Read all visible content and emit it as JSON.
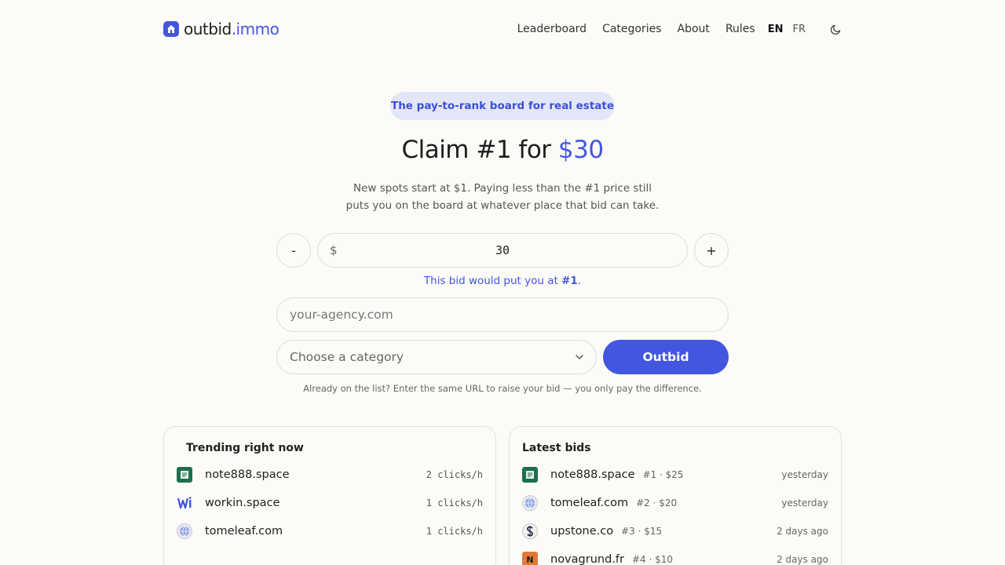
{
  "header": {
    "logo_brand": "outbid",
    "logo_domain": ".immo",
    "nav": [
      "Leaderboard",
      "Categories",
      "About",
      "Rules"
    ],
    "lang_en": "EN",
    "lang_fr": "FR"
  },
  "hero": {
    "pill": "The pay-to-rank board for real estate",
    "headline_prefix": "Claim #1 for ",
    "headline_price": "$30",
    "sub": "New spots start at $1. Paying less than the #1 price still puts you on the board at whatever place that bid can take."
  },
  "bid": {
    "minus": "-",
    "plus": "+",
    "currency": "$",
    "amount": "30",
    "rank_prefix": "This bid would put you at ",
    "rank_value": "#1",
    "rank_suffix": ".",
    "url_placeholder": "your-agency.com",
    "category_placeholder": "Choose a category",
    "submit": "Outbid",
    "hint": "Already on the list? Enter the same URL to raise your bid — you only pay the difference."
  },
  "trending": {
    "title": "Trending right now",
    "items": [
      {
        "site": "note888.space",
        "clicks": "2 clicks/h",
        "icon": "note888-favicon"
      },
      {
        "site": "workin.space",
        "clicks": "1 clicks/h",
        "icon": "workin-favicon"
      },
      {
        "site": "tomeleaf.com",
        "clicks": "1 clicks/h",
        "icon": "globe-favicon"
      }
    ]
  },
  "latest": {
    "title": "Latest bids",
    "items": [
      {
        "site": "note888.space",
        "meta": "#1 · $25",
        "when": "yesterday",
        "icon": "note888-favicon"
      },
      {
        "site": "tomeleaf.com",
        "meta": "#2 · $20",
        "when": "yesterday",
        "icon": "globe-favicon"
      },
      {
        "site": "upstone.co",
        "meta": "#3 · $15",
        "when": "2 days ago",
        "icon": "upstone-favicon"
      },
      {
        "site": "novagrund.fr",
        "meta": "#4 · $10",
        "when": "2 days ago",
        "icon": "novagrund-favicon",
        "letter": "N"
      }
    ]
  },
  "colors": {
    "accent": "#4356e0",
    "background": "#fcfbf8",
    "pill_bg": "#e3e6f8"
  }
}
